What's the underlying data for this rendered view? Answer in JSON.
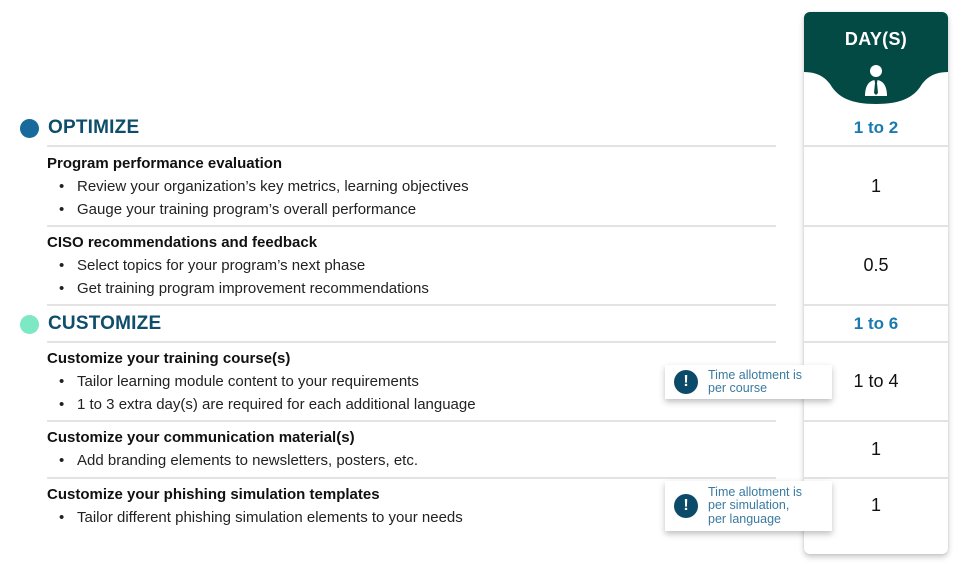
{
  "days_column": {
    "header": "DAY(S)",
    "icon": "person-with-tie-icon"
  },
  "sections": [
    {
      "title": "OPTIMIZE",
      "dot_color": "#186a9c",
      "days": "1 to 2",
      "items": [
        {
          "title": "Program performance evaluation",
          "bullets": [
            "Review your organization’s key metrics, learning objectives",
            "Gauge your training program’s overall performance"
          ],
          "days": "1"
        },
        {
          "title": "CISO recommendations and feedback",
          "bullets": [
            "Select topics for your program’s next phase",
            "Get training program improvement recommendations"
          ],
          "days": "0.5"
        }
      ]
    },
    {
      "title": "CUSTOMIZE",
      "dot_color": "#7ce8c4",
      "days": "1 to 6",
      "items": [
        {
          "title": "Customize your training course(s)",
          "bullets": [
            "Tailor learning module content to your requirements",
            "1 to 3 extra day(s) are required for each additional language"
          ],
          "days": "1 to 4",
          "note": [
            "Time allotment is",
            "per course"
          ]
        },
        {
          "title": "Customize your communication material(s)",
          "bullets": [
            "Add branding elements to newsletters, posters, etc."
          ],
          "days": "1"
        },
        {
          "title": "Customize your phishing simulation templates",
          "bullets": [
            "Tailor different phishing simulation elements to your needs"
          ],
          "days": "1",
          "note": [
            "Time allotment is",
            "per simulation,",
            "per language"
          ]
        }
      ]
    }
  ],
  "bullet_char": "•",
  "note_icon": "exclamation-icon",
  "colors": {
    "header_bg": "#034a44",
    "section_title": "#0e4d6b",
    "section_days": "#1a7ab0",
    "note_icon_bg": "#0c4a6a",
    "note_text": "#3a7aa0"
  }
}
